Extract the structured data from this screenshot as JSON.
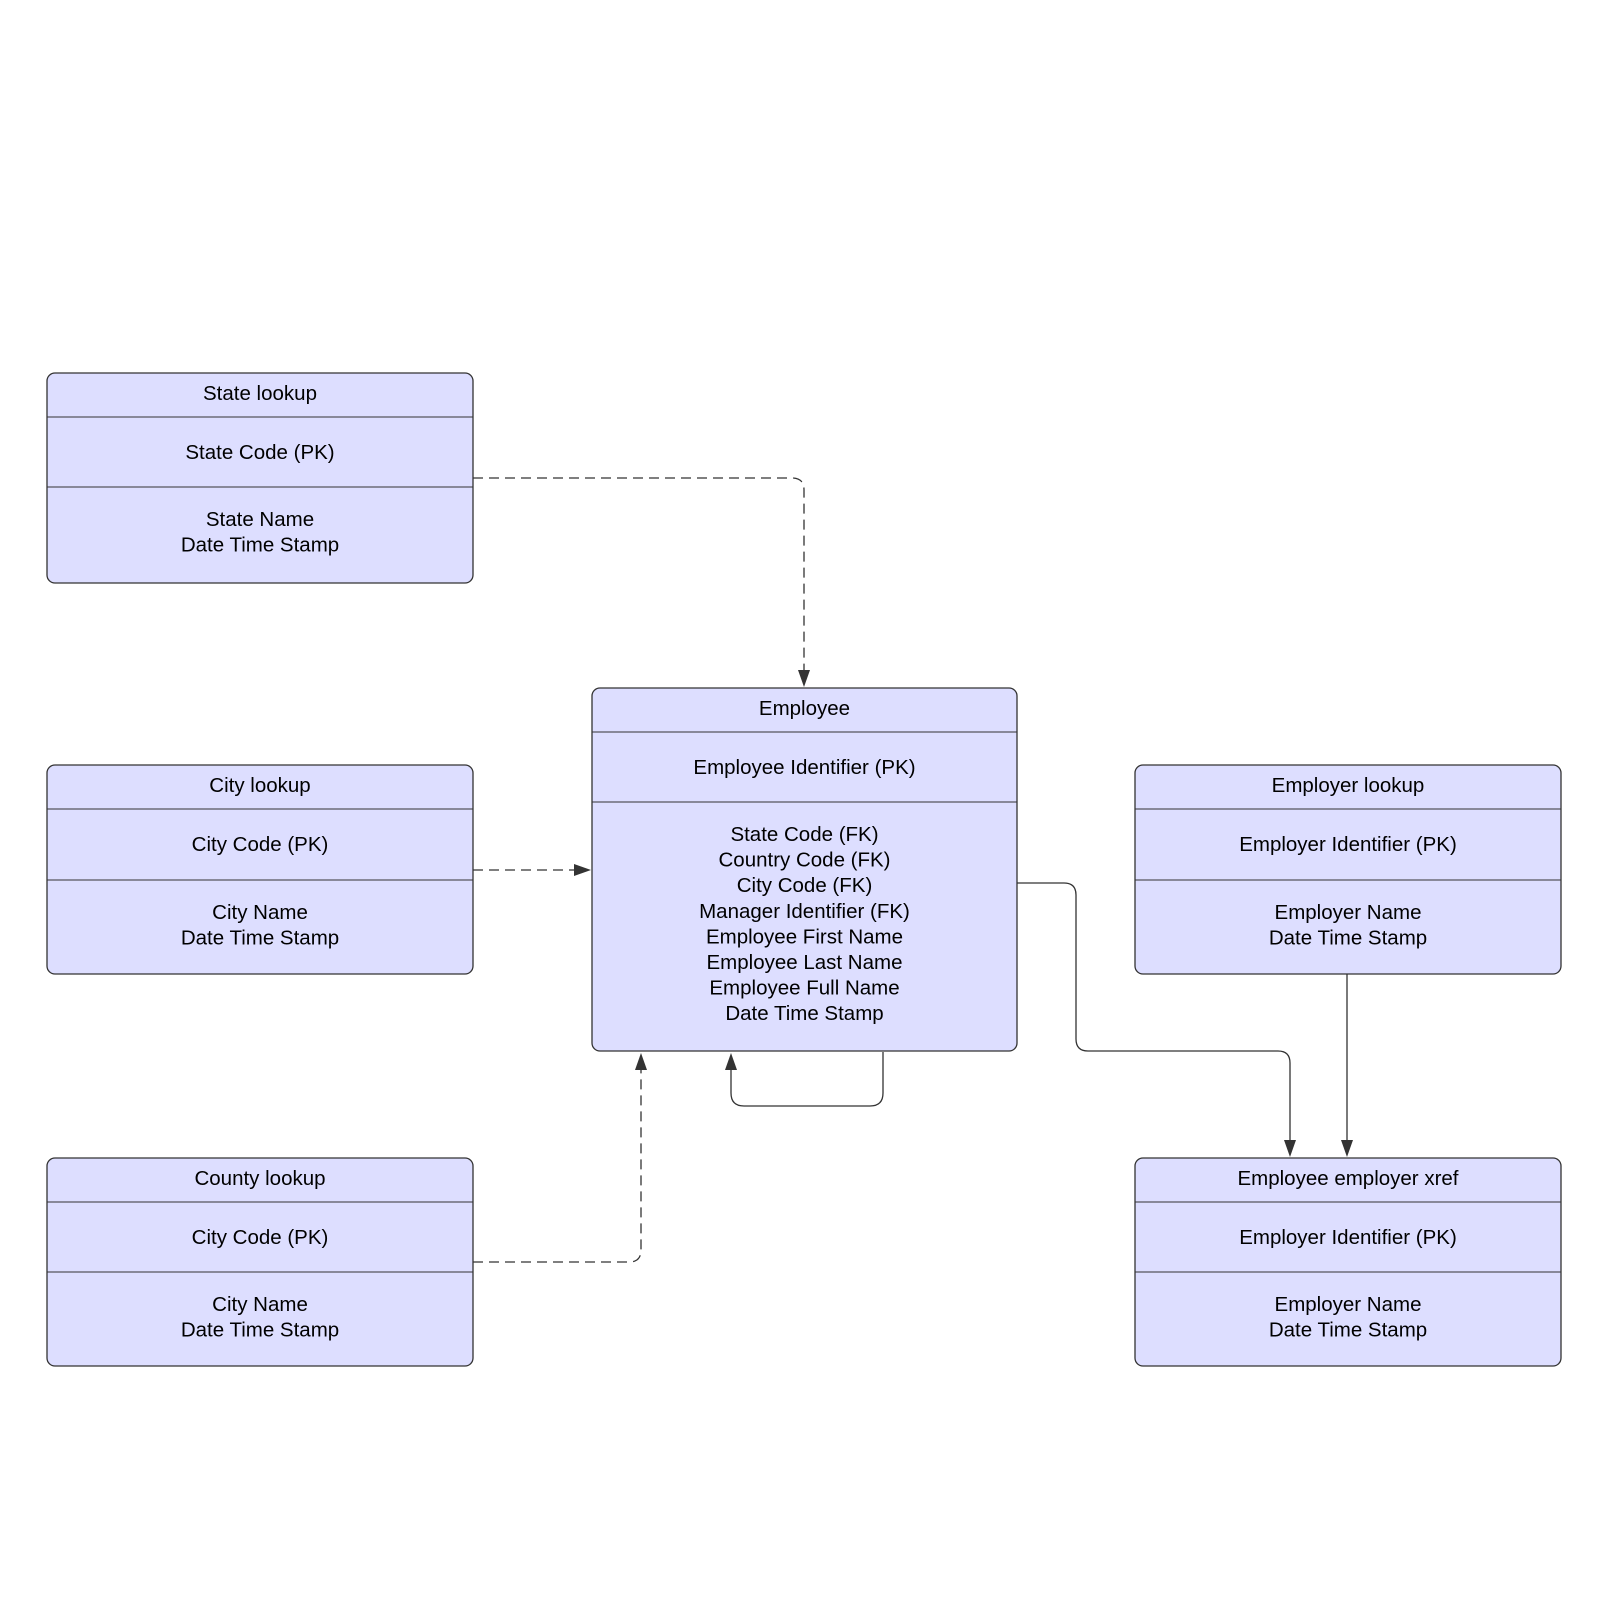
{
  "entities": {
    "state": {
      "title": "State lookup",
      "pk": [
        "State Code (PK)"
      ],
      "attrs": [
        "State Name",
        "Date Time Stamp"
      ]
    },
    "city": {
      "title": "City lookup",
      "pk": [
        "City Code (PK)"
      ],
      "attrs": [
        "City Name",
        "Date Time Stamp"
      ]
    },
    "county": {
      "title": "County lookup",
      "pk": [
        "City Code (PK)"
      ],
      "attrs": [
        "City Name",
        "Date Time Stamp"
      ]
    },
    "employee": {
      "title": "Employee",
      "pk": [
        "Employee Identifier (PK)"
      ],
      "attrs": [
        "State Code (FK)",
        "Country Code (FK)",
        "City Code (FK)",
        "Manager Identifier (FK)",
        "Employee First Name",
        "Employee Last Name",
        "Employee Full Name",
        "Date Time Stamp"
      ]
    },
    "employer": {
      "title": "Employer lookup",
      "pk": [
        "Employer Identifier (PK)"
      ],
      "attrs": [
        "Employer Name",
        "Date Time Stamp"
      ]
    },
    "xref": {
      "title": "Employee employer xref",
      "pk": [
        "Employer Identifier (PK)"
      ],
      "attrs": [
        "Employer Name",
        "Date Time Stamp"
      ]
    }
  },
  "relationships": [
    {
      "from": "state",
      "to": "employee",
      "style": "dashed"
    },
    {
      "from": "city",
      "to": "employee",
      "style": "dashed"
    },
    {
      "from": "county",
      "to": "employee",
      "style": "dashed"
    },
    {
      "from": "employee",
      "to": "employee",
      "style": "solid"
    },
    {
      "from": "employee",
      "to": "xref",
      "style": "solid"
    },
    {
      "from": "employer",
      "to": "xref",
      "style": "solid"
    }
  ],
  "colors": {
    "fill": "#dddeff",
    "stroke": "#333333"
  }
}
